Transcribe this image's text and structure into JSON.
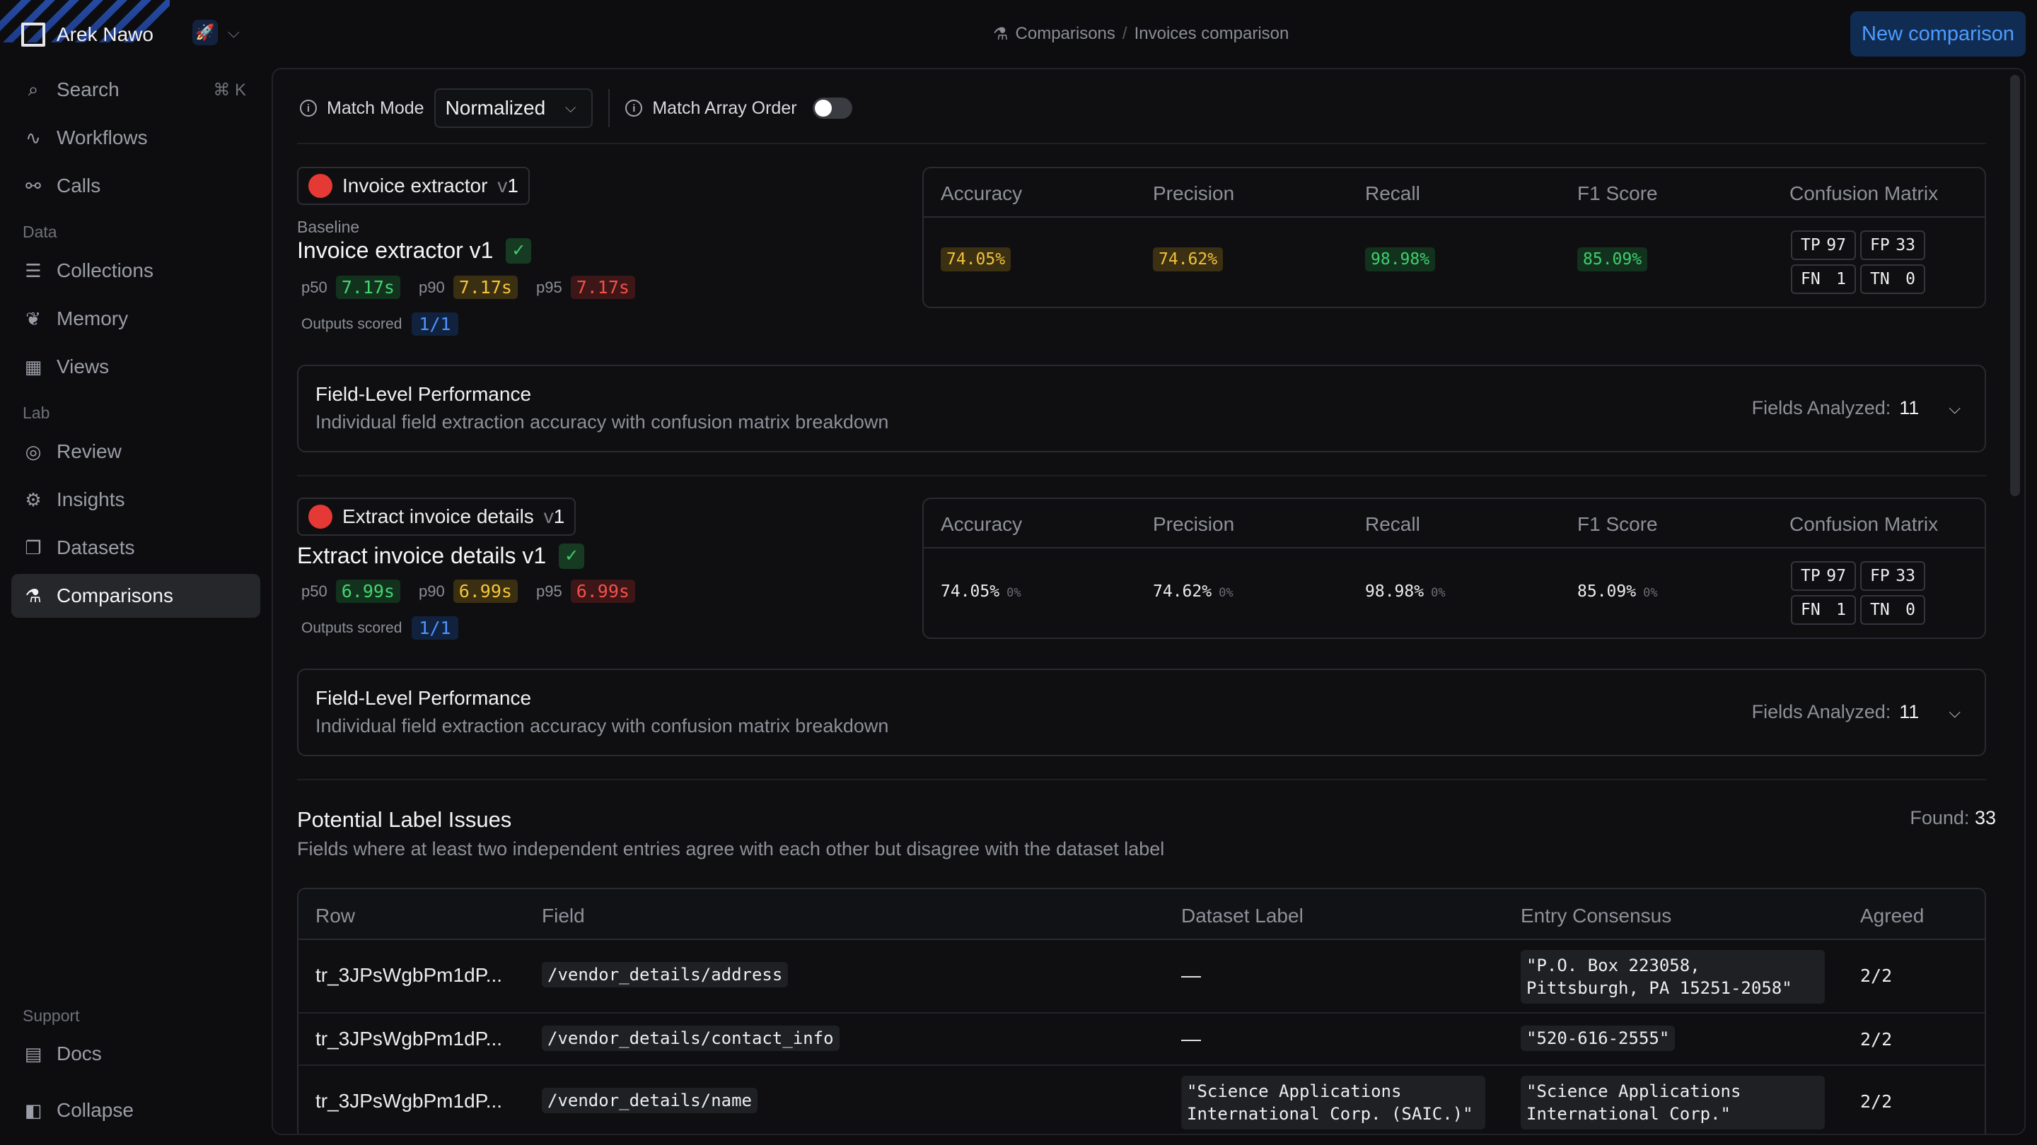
{
  "sidebar": {
    "workspace": "Arek Nawo",
    "items": [
      {
        "label": "Search",
        "icon": "search-icon",
        "shortcut": "⌘ K"
      },
      {
        "label": "Workflows",
        "icon": "workflow-icon"
      },
      {
        "label": "Calls",
        "icon": "calls-icon"
      }
    ],
    "groups": {
      "data": {
        "label": "Data",
        "items": [
          {
            "label": "Collections",
            "icon": "database-icon"
          },
          {
            "label": "Memory",
            "icon": "brain-icon"
          },
          {
            "label": "Views",
            "icon": "grid-icon"
          }
        ]
      },
      "lab": {
        "label": "Lab",
        "items": [
          {
            "label": "Review",
            "icon": "review-icon"
          },
          {
            "label": "Insights",
            "icon": "insights-icon"
          },
          {
            "label": "Datasets",
            "icon": "datasets-icon"
          },
          {
            "label": "Comparisons",
            "icon": "flask-icon",
            "active": true
          }
        ]
      },
      "support": {
        "label": "Support",
        "items": [
          {
            "label": "Docs",
            "icon": "docs-icon"
          },
          {
            "label": "Collapse",
            "icon": "collapse-icon"
          }
        ]
      }
    }
  },
  "header": {
    "breadcrumb": [
      "Comparisons",
      "Invoices comparison"
    ],
    "new_button": "New comparison"
  },
  "toolbar": {
    "match_mode_label": "Match Mode",
    "match_mode_value": "Normalized",
    "match_array_order_label": "Match Array Order",
    "match_array_order_on": false
  },
  "metric_headers": [
    "Accuracy",
    "Precision",
    "Recall",
    "F1 Score",
    "Confusion Matrix"
  ],
  "entries": [
    {
      "pill_name": "Invoice extractor",
      "pill_version_prefix": "v",
      "pill_version": "1",
      "baseline_label": "Baseline",
      "title": "Invoice extractor v1",
      "latency": {
        "p50_label": "p50",
        "p50": "7.17s",
        "p90_label": "p90",
        "p90": "7.17s",
        "p95_label": "p95",
        "p95": "7.17s"
      },
      "outputs_scored_label": "Outputs scored",
      "outputs_scored": "1/1",
      "metrics": {
        "accuracy": "74.05%",
        "precision": "74.62%",
        "recall": "98.98%",
        "f1": "85.09%"
      },
      "confusion": {
        "tp_label": "TP",
        "tp": "97",
        "fp_label": "FP",
        "fp": "33",
        "fn_label": "FN",
        "fn": "1",
        "tn_label": "TN",
        "tn": "0"
      },
      "field_card": {
        "title": "Field-Level Performance",
        "desc": "Individual field extraction accuracy with confusion matrix breakdown",
        "fields_label": "Fields Analyzed:",
        "fields_count": "11"
      }
    },
    {
      "pill_name": "Extract invoice details",
      "pill_version_prefix": "v",
      "pill_version": "1",
      "title": "Extract invoice details v1",
      "latency": {
        "p50_label": "p50",
        "p50": "6.99s",
        "p90_label": "p90",
        "p90": "6.99s",
        "p95_label": "p95",
        "p95": "6.99s"
      },
      "outputs_scored_label": "Outputs scored",
      "outputs_scored": "1/1",
      "metrics": {
        "accuracy": "74.05%",
        "precision": "74.62%",
        "recall": "98.98%",
        "f1": "85.09%",
        "delta": "0%"
      },
      "confusion": {
        "tp_label": "TP",
        "tp": "97",
        "fp_label": "FP",
        "fp": "33",
        "fn_label": "FN",
        "fn": "1",
        "tn_label": "TN",
        "tn": "0"
      },
      "field_card": {
        "title": "Field-Level Performance",
        "desc": "Individual field extraction accuracy with confusion matrix breakdown",
        "fields_label": "Fields Analyzed:",
        "fields_count": "11"
      }
    }
  ],
  "label_issues": {
    "title": "Potential Label Issues",
    "desc": "Fields where at least two independent entries agree with each other but disagree with the dataset label",
    "found_label": "Found:",
    "found_count": "33",
    "columns": [
      "Row",
      "Field",
      "Dataset Label",
      "Entry Consensus",
      "Agreed"
    ],
    "rows": [
      {
        "row": "tr_3JPsWgbPm1dP...",
        "field": "/vendor_details/address",
        "dataset_label": "—",
        "consensus": "\"P.O. Box 223058, Pittsburgh, PA 15251-2058\"",
        "agreed": "2/2"
      },
      {
        "row": "tr_3JPsWgbPm1dP...",
        "field": "/vendor_details/contact_info",
        "dataset_label": "—",
        "consensus": "\"520-616-2555\"",
        "agreed": "2/2"
      },
      {
        "row": "tr_3JPsWgbPm1dP...",
        "field": "/vendor_details/name",
        "dataset_label": "\"Science Applications International Corp. (SAIC.)\"",
        "consensus": "\"Science Applications International Corp.\"",
        "agreed": "2/2"
      }
    ]
  }
}
